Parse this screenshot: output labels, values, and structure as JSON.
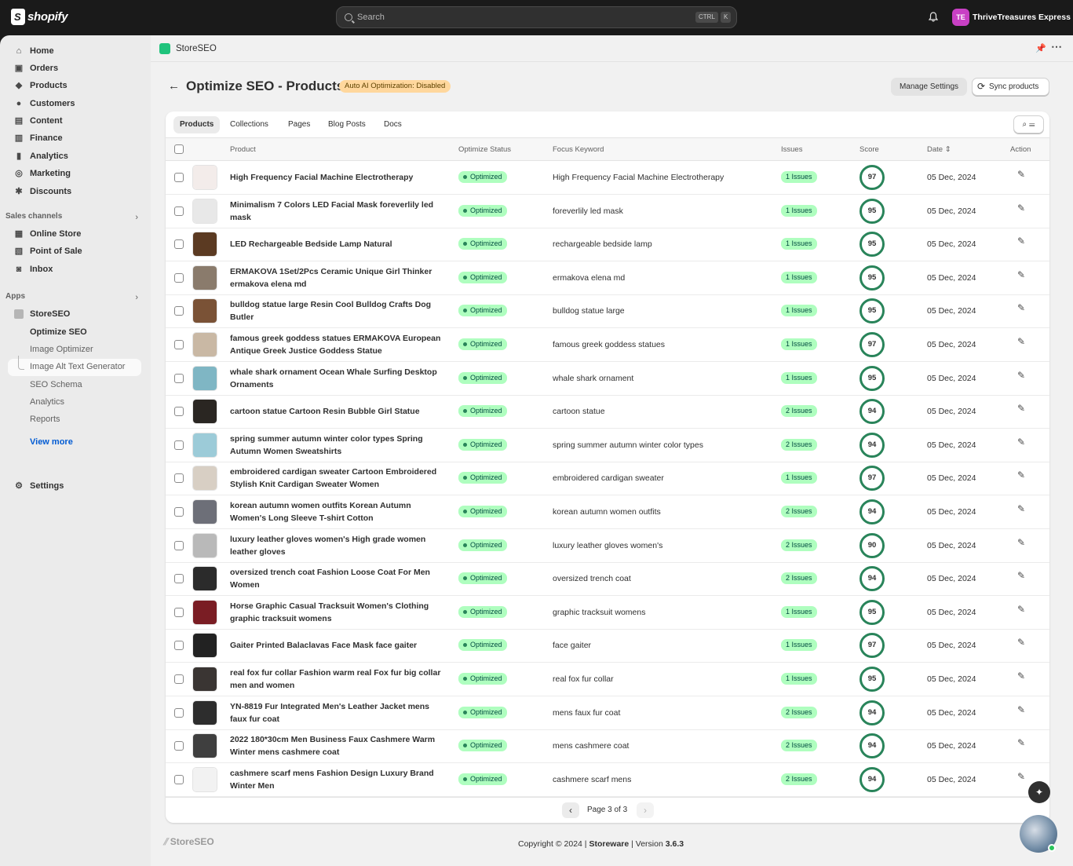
{
  "topbar": {
    "brand": "shopify",
    "search_placeholder": "Search",
    "shortcut_ctrl": "CTRL",
    "shortcut_key": "K",
    "store_initials": "TE",
    "store_name": "ThriveTreasures Express"
  },
  "sidebar": {
    "items": [
      {
        "label": "Home",
        "icon": "home-icon"
      },
      {
        "label": "Orders",
        "icon": "inbox-icon"
      },
      {
        "label": "Products",
        "icon": "tag-icon"
      },
      {
        "label": "Customers",
        "icon": "person-icon"
      },
      {
        "label": "Content",
        "icon": "image-icon"
      },
      {
        "label": "Finance",
        "icon": "bank-icon"
      },
      {
        "label": "Analytics",
        "icon": "bar-chart-icon"
      },
      {
        "label": "Marketing",
        "icon": "target-icon"
      },
      {
        "label": "Discounts",
        "icon": "discount-icon"
      }
    ],
    "sales_channels_label": "Sales channels",
    "sales_channels": [
      {
        "label": "Online Store",
        "icon": "store-icon"
      },
      {
        "label": "Point of Sale",
        "icon": "pos-icon"
      },
      {
        "label": "Inbox",
        "icon": "chat-icon"
      }
    ],
    "apps_label": "Apps",
    "app_name": "StoreSEO",
    "app_subitems": [
      "Optimize SEO",
      "Image Optimizer",
      "Image Alt Text Generator",
      "SEO Schema",
      "Analytics",
      "Reports"
    ],
    "view_more": "View more",
    "settings": "Settings"
  },
  "app_header": {
    "name": "StoreSEO"
  },
  "page": {
    "title": "Optimize SEO - Products",
    "ai_badge": "Auto AI Optimization: Disabled",
    "manage_settings": "Manage Settings",
    "sync_products": "Sync products"
  },
  "tabs": [
    "Products",
    "Collections",
    "Pages",
    "Blog Posts",
    "Docs"
  ],
  "columns": [
    "Product",
    "Optimize Status",
    "Focus Keyword",
    "Issues",
    "Score",
    "Date",
    "Action"
  ],
  "rows": [
    {
      "name": "High Frequency Facial Machine Electrotherapy",
      "status": "Optimized",
      "keyword": "High Frequency Facial Machine Electrotherapy",
      "issues": "1 Issues",
      "score": "97",
      "date": "05 Dec, 2024",
      "thumb": "#f3ecea"
    },
    {
      "name": "Minimalism 7 Colors LED Facial Mask foreverlily led mask",
      "status": "Optimized",
      "keyword": "foreverlily led mask",
      "issues": "1 Issues",
      "score": "95",
      "date": "05 Dec, 2024",
      "thumb": "#e8e8e8"
    },
    {
      "name": "LED Rechargeable Bedside Lamp Natural",
      "status": "Optimized",
      "keyword": "rechargeable bedside lamp",
      "issues": "1 Issues",
      "score": "95",
      "date": "05 Dec, 2024",
      "thumb": "#5b3a22"
    },
    {
      "name": "ERMAKOVA 1Set/2Pcs Ceramic Unique Girl Thinker ermakova elena md",
      "status": "Optimized",
      "keyword": "ermakova elena md",
      "issues": "1 Issues",
      "score": "95",
      "date": "05 Dec, 2024",
      "thumb": "#8a7b6c"
    },
    {
      "name": "bulldog statue large Resin Cool Bulldog Crafts Dog Butler",
      "status": "Optimized",
      "keyword": "bulldog statue large",
      "issues": "1 Issues",
      "score": "95",
      "date": "05 Dec, 2024",
      "thumb": "#7a5236"
    },
    {
      "name": "famous greek goddess statues ERMAKOVA European Antique Greek Justice Goddess Statue",
      "status": "Optimized",
      "keyword": "famous greek goddess statues",
      "issues": "1 Issues",
      "score": "97",
      "date": "05 Dec, 2024",
      "thumb": "#c9b8a4"
    },
    {
      "name": "whale shark ornament Ocean Whale Surfing Desktop Ornaments",
      "status": "Optimized",
      "keyword": "whale shark ornament",
      "issues": "1 Issues",
      "score": "95",
      "date": "05 Dec, 2024",
      "thumb": "#7fb6c4"
    },
    {
      "name": "cartoon statue Cartoon Resin Bubble Girl Statue",
      "status": "Optimized",
      "keyword": "cartoon statue",
      "issues": "2 Issues",
      "score": "94",
      "date": "05 Dec, 2024",
      "thumb": "#2a2622"
    },
    {
      "name": "spring summer autumn winter color types Spring Autumn Women Sweatshirts",
      "status": "Optimized",
      "keyword": "spring summer autumn winter color types",
      "issues": "2 Issues",
      "score": "94",
      "date": "05 Dec, 2024",
      "thumb": "#9ccbd8"
    },
    {
      "name": "embroidered cardigan sweater Cartoon Embroidered Stylish Knit Cardigan Sweater Women",
      "status": "Optimized",
      "keyword": "embroidered cardigan sweater",
      "issues": "1 Issues",
      "score": "97",
      "date": "05 Dec, 2024",
      "thumb": "#d8cfc4"
    },
    {
      "name": "korean autumn women outfits Korean Autumn Women's Long Sleeve T-shirt Cotton",
      "status": "Optimized",
      "keyword": "korean autumn women outfits",
      "issues": "2 Issues",
      "score": "94",
      "date": "05 Dec, 2024",
      "thumb": "#6d6f78"
    },
    {
      "name": "luxury leather gloves women's High grade women leather gloves",
      "status": "Optimized",
      "keyword": "luxury leather gloves women's",
      "issues": "2 Issues",
      "score": "90",
      "date": "05 Dec, 2024",
      "thumb": "#b9b9b9"
    },
    {
      "name": "oversized trench coat Fashion Loose Coat For Men Women",
      "status": "Optimized",
      "keyword": "oversized trench coat",
      "issues": "2 Issues",
      "score": "94",
      "date": "05 Dec, 2024",
      "thumb": "#2b2b2b"
    },
    {
      "name": "Horse Graphic Casual Tracksuit Women's Clothing graphic tracksuit womens",
      "status": "Optimized",
      "keyword": "graphic tracksuit womens",
      "issues": "1 Issues",
      "score": "95",
      "date": "05 Dec, 2024",
      "thumb": "#7a1d24"
    },
    {
      "name": "Gaiter Printed Balaclavas Face Mask  face gaiter",
      "status": "Optimized",
      "keyword": "face gaiter",
      "issues": "1 Issues",
      "score": "97",
      "date": "05 Dec, 2024",
      "thumb": "#222222"
    },
    {
      "name": "real fox fur collar Fashion warm real Fox fur big collar men and women",
      "status": "Optimized",
      "keyword": "real fox fur collar",
      "issues": "1 Issues",
      "score": "95",
      "date": "05 Dec, 2024",
      "thumb": "#3a3533"
    },
    {
      "name": "YN-8819 Fur Integrated Men's Leather Jacket mens faux fur coat",
      "status": "Optimized",
      "keyword": "mens faux fur coat",
      "issues": "2 Issues",
      "score": "94",
      "date": "05 Dec, 2024",
      "thumb": "#2d2d2d"
    },
    {
      "name": "2022 180*30cm Men Business Faux Cashmere Warm Winter mens cashmere coat",
      "status": "Optimized",
      "keyword": "mens cashmere coat",
      "issues": "2 Issues",
      "score": "94",
      "date": "05 Dec, 2024",
      "thumb": "#3f3f3f"
    },
    {
      "name": "cashmere scarf mens Fashion Design Luxury Brand Winter Men",
      "status": "Optimized",
      "keyword": "cashmere scarf mens",
      "issues": "2 Issues",
      "score": "94",
      "date": "05 Dec, 2024",
      "thumb": "#f2f2f2"
    }
  ],
  "pagination": {
    "label": "Page 3 of 3"
  },
  "footer": {
    "logo": "StoreSEO",
    "copyright": "Copyright © 2024 |",
    "company": "Storeware",
    "version_label": "| Version",
    "version": "3.6.3"
  },
  "colors": {
    "accent_green": "#29845a",
    "badge_green": "#affebf",
    "badge_orange": "#ffd79d",
    "store_badge": "#c840c4"
  }
}
